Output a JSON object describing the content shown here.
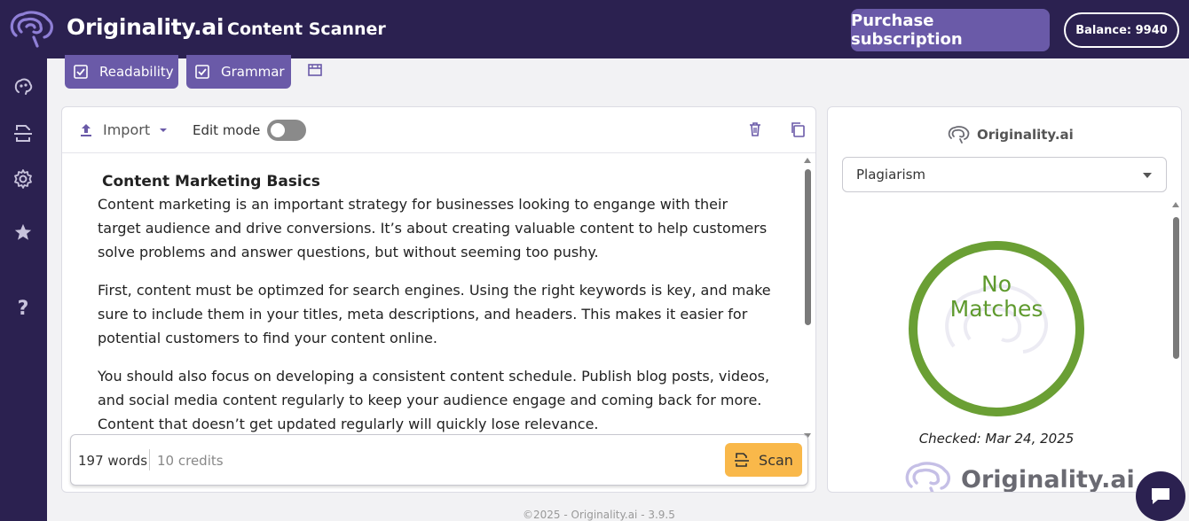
{
  "header": {
    "brand": "Originality.ai",
    "app_title": "Content Scanner",
    "purchase_label": "Purchase subscription",
    "balance_label": "Balance: 9940"
  },
  "sidebar": {
    "items": [
      {
        "icon": "brain-icon"
      },
      {
        "icon": "scan-icon"
      },
      {
        "icon": "gear-icon"
      },
      {
        "icon": "star-icon"
      },
      {
        "icon": "help-icon",
        "label": "?"
      }
    ]
  },
  "toolbar": {
    "chips": [
      {
        "label": "Readability",
        "checked": true
      },
      {
        "label": "Grammar",
        "checked": true
      }
    ]
  },
  "editor": {
    "import_label": "Import",
    "edit_mode_label": "Edit mode",
    "edit_mode_on": false,
    "title": "Content Marketing Basics",
    "paragraphs": [
      "Content marketing is an important strategy for businesses looking to engange with their target audience and drive conversions.  It’s about creating valuable content to help customers solve problems and answer questions, but without seeming too pushy.",
      "First, content must be optimzed for search engines.  Using the right keywords is key, and make sure to include them in your titles, meta descriptions, and headers.  This makes it easier for potential customers to find your content online.",
      "You should also focus on developing a consistent content schedule.  Publish blog posts, videos, and social media content regularly to keep your audience engage and coming back for more. Content that doesn’t get updated regularly will quickly lose relevance."
    ],
    "words_label": "197 words",
    "credits_label": "10 credits",
    "scan_label": "Scan"
  },
  "results": {
    "brand": "Originality.ai",
    "mode_selected": "Plagiarism",
    "result_line1": "No",
    "result_line2": "Matches",
    "checked_label": "Checked: Mar 24, 2025",
    "footer_brand": "Originality.ai",
    "ring_color": "#6a9f34"
  },
  "footer": {
    "copyright": "©2025 - Originality.ai - 3.9.5"
  },
  "colors": {
    "header_bg": "#2b2150",
    "accent_purple": "#6a5aa8",
    "scan_orange": "#f9b84a",
    "success_green": "#5f9a2e"
  }
}
